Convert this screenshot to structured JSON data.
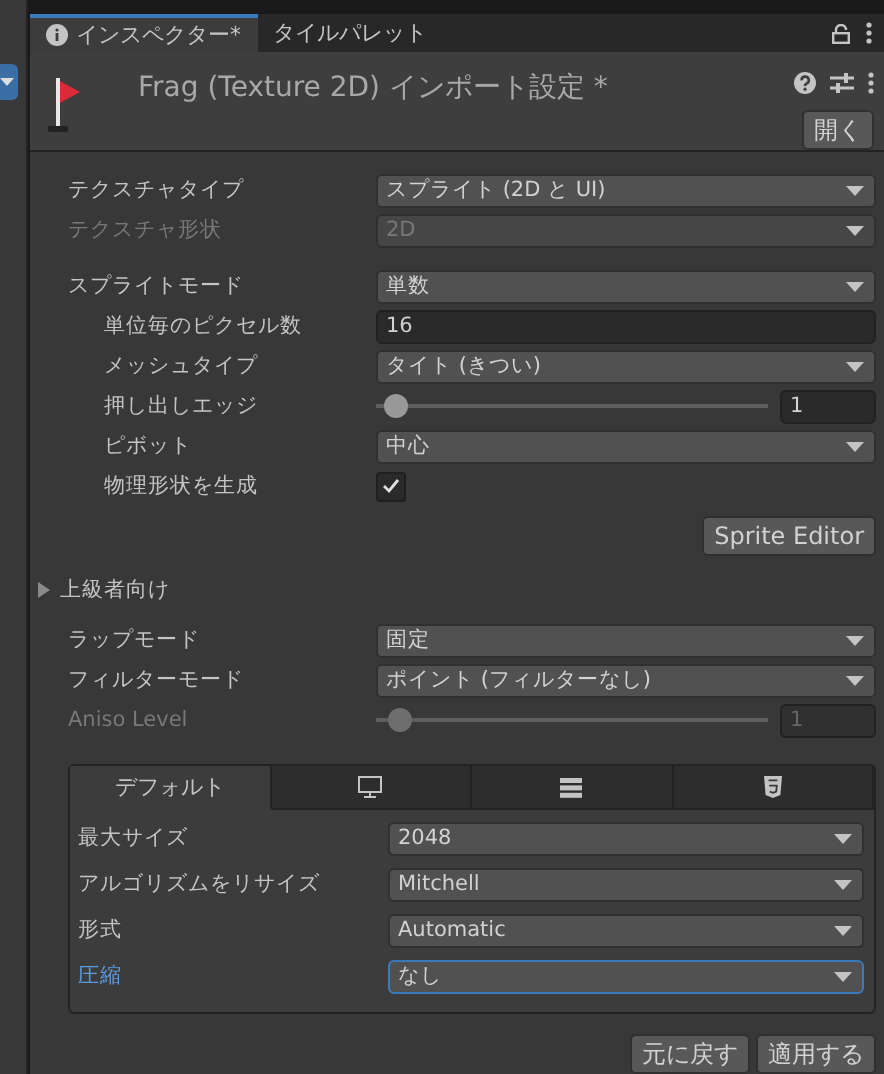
{
  "tabs": [
    {
      "label": "インスペクター*",
      "selected": true
    },
    {
      "label": "タイルパレット",
      "selected": false
    }
  ],
  "header": {
    "title": "Frag (Texture 2D) インポート設定 *",
    "open_button": "開く"
  },
  "rows": [
    {
      "kind": "dropdown",
      "label": "テクスチャタイプ",
      "value": "スプライト (2D と UI)",
      "indent": false,
      "disabled": false
    },
    {
      "kind": "dropdown",
      "label": "テクスチャ形状",
      "value": "2D",
      "indent": false,
      "disabled": true
    },
    {
      "kind": "gap"
    },
    {
      "kind": "dropdown",
      "label": "スプライトモード",
      "value": "単数",
      "indent": false,
      "disabled": false
    },
    {
      "kind": "input",
      "label": "単位毎のピクセル数",
      "value": "16",
      "indent": true,
      "disabled": false
    },
    {
      "kind": "dropdown",
      "label": "メッシュタイプ",
      "value": "タイト (きつい)",
      "indent": true,
      "disabled": false
    },
    {
      "kind": "slider",
      "label": "押し出しエッジ",
      "value": "1",
      "level": 0.05,
      "indent": true,
      "disabled": false
    },
    {
      "kind": "dropdown",
      "label": "ピボット",
      "value": "中心",
      "indent": true,
      "disabled": false
    },
    {
      "kind": "checkbox",
      "label": "物理形状を生成",
      "checked": true,
      "indent": true,
      "disabled": false
    },
    {
      "kind": "button",
      "label": "Sprite Editor"
    },
    {
      "kind": "foldout",
      "label": "上級者向け",
      "expanded": false
    },
    {
      "kind": "dropdown",
      "label": "ラップモード",
      "value": "固定",
      "indent": false,
      "disabled": false
    },
    {
      "kind": "dropdown",
      "label": "フィルターモード",
      "value": "ポイント (フィルターなし)",
      "indent": false,
      "disabled": false
    },
    {
      "kind": "slider",
      "label": "Aniso Level",
      "value": "1",
      "level": 0.06,
      "indent": false,
      "disabled": true
    }
  ],
  "platform": {
    "tabs": [
      {
        "kind": "text",
        "label": "デフォルト",
        "selected": true
      },
      {
        "kind": "monitor",
        "selected": false
      },
      {
        "kind": "server",
        "selected": false
      },
      {
        "kind": "html5",
        "selected": false
      }
    ],
    "rows": [
      {
        "label": "最大サイズ",
        "value": "2048",
        "focused": false
      },
      {
        "label": "アルゴリズムをリサイズ",
        "value": "Mitchell",
        "focused": false
      },
      {
        "label": "形式",
        "value": "Automatic",
        "focused": false
      },
      {
        "label": "圧縮",
        "value": "なし",
        "focused": true
      }
    ]
  },
  "footer": {
    "buttons": [
      "元に戻す",
      "適用する"
    ]
  }
}
